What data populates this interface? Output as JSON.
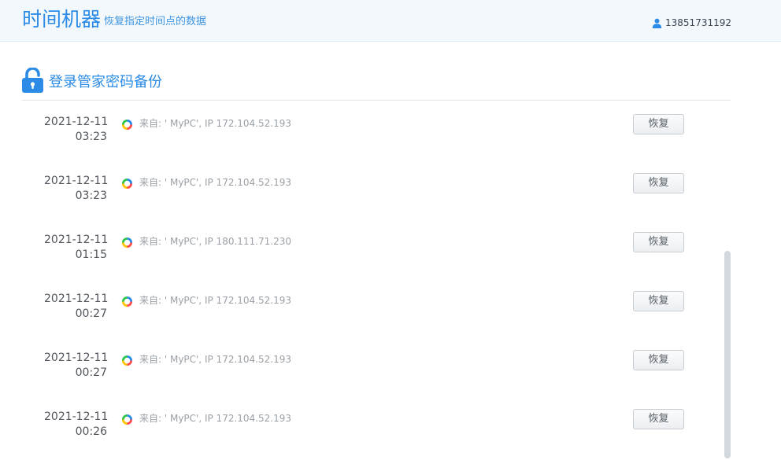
{
  "header": {
    "title": "时间机器",
    "subtitle": "恢复指定时间点的数据",
    "user_phone": "13851731192"
  },
  "section": {
    "title": "登录管家密码备份"
  },
  "backups": [
    {
      "date": "2021-12-11",
      "time": "03:23",
      "source": "来自: ' MyPC', IP 172.104.52.193",
      "action": "恢复"
    },
    {
      "date": "2021-12-11",
      "time": "03:23",
      "source": "来自: ' MyPC', IP 172.104.52.193",
      "action": "恢复"
    },
    {
      "date": "2021-12-11",
      "time": "01:15",
      "source": "来自: ' MyPC', IP 180.111.71.230",
      "action": "恢复"
    },
    {
      "date": "2021-12-11",
      "time": "00:27",
      "source": "来自: ' MyPC', IP 172.104.52.193",
      "action": "恢复"
    },
    {
      "date": "2021-12-11",
      "time": "00:27",
      "source": "来自: ' MyPC', IP 172.104.52.193",
      "action": "恢复"
    },
    {
      "date": "2021-12-11",
      "time": "00:26",
      "source": "来自: ' MyPC', IP 172.104.52.193",
      "action": "恢复"
    }
  ],
  "icons": {
    "user": "user-icon",
    "lock": "open-lock-icon",
    "source": "app-logo-icon"
  },
  "colors": {
    "accent": "#2b8be6",
    "header_bg": "#f3f8fd"
  }
}
